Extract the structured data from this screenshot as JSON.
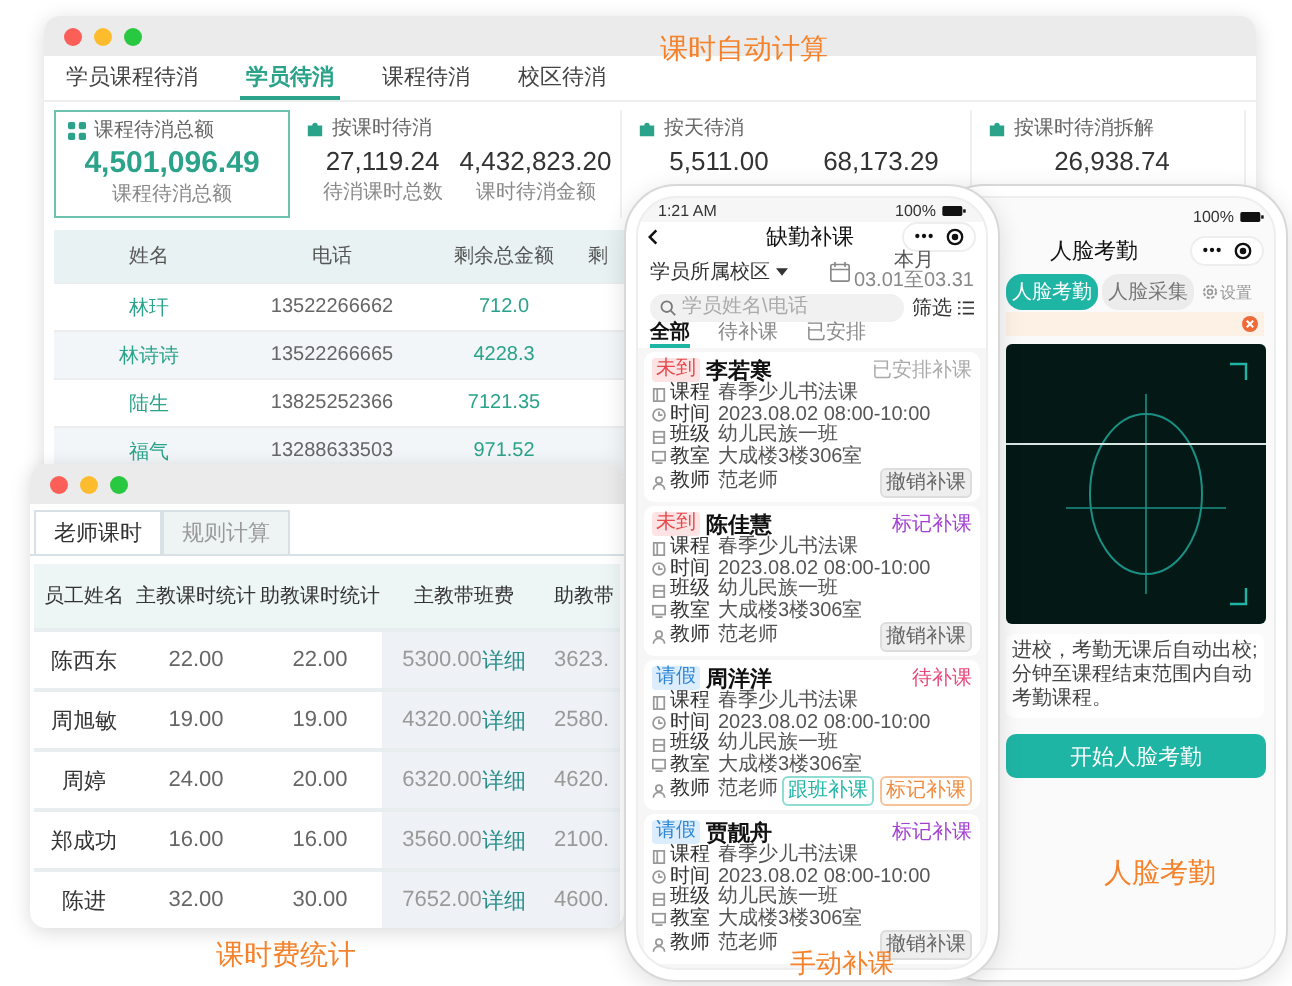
{
  "course_window": {
    "caption": "课时自动计算",
    "tabs": [
      {
        "label": "学员课程待消",
        "selected": false
      },
      {
        "label": "学员待消",
        "selected": true
      },
      {
        "label": "课程待消",
        "selected": false
      },
      {
        "label": "校区待消",
        "selected": false
      }
    ],
    "summary": {
      "title": "课程待消总额",
      "value": "4,501,096.49",
      "label": "课程待消总额"
    },
    "groups": [
      {
        "title": "按课时待消",
        "stats": [
          {
            "value": "27,119.24",
            "label": "待消课时总数"
          },
          {
            "value": "4,432,823.20",
            "label": "课时待消金额"
          }
        ]
      },
      {
        "title": "按天待消",
        "stats": [
          {
            "value": "5,511.00"
          },
          {
            "value": "68,173.29"
          }
        ]
      },
      {
        "title": "按课时待消拆解",
        "stats": [
          {
            "value": "26,938.74"
          }
        ]
      }
    ],
    "table": {
      "columns": [
        "姓名",
        "电话",
        "剩余总金额",
        "剩"
      ],
      "rows": [
        [
          "林玕",
          "13522266662",
          "712.0"
        ],
        [
          "林诗诗",
          "13522266665",
          "4228.3"
        ],
        [
          "陆生",
          "13825252366",
          "7121.35"
        ],
        [
          "福气",
          "13288633503",
          "971.52"
        ]
      ]
    }
  },
  "teacher_window": {
    "caption": "课时费统计",
    "tabs": [
      {
        "label": "老师课时",
        "selected": true
      },
      {
        "label": "规则计算",
        "selected": false
      }
    ],
    "table": {
      "columns": [
        "员工姓名",
        "主教课时统计",
        "助教课时统计",
        "主教带班费",
        "助教带"
      ],
      "rows": [
        {
          "cells": [
            "陈西东",
            "22.00",
            "22.00"
          ],
          "main_fee": "5300.00",
          "link": "详细",
          "column_5": "3623."
        },
        {
          "cells": [
            "周旭敏",
            "19.00",
            "19.00"
          ],
          "main_fee": "4320.00",
          "link": "详细",
          "column_5": "2580."
        },
        {
          "cells": [
            "周婷",
            "24.00",
            "20.00"
          ],
          "main_fee": "6320.00",
          "link": "详细",
          "column_5": "4620."
        },
        {
          "cells": [
            "郑成功",
            "16.00",
            "16.00"
          ],
          "main_fee": "3560.00",
          "link": "详细",
          "column_5": "2100."
        },
        {
          "cells": [
            "陈进",
            "32.00",
            "30.00"
          ],
          "main_fee": "7652.00",
          "link": "详细",
          "column_5": "4600."
        }
      ]
    }
  },
  "makeup_phone": {
    "caption": "手动补课",
    "time": "1:21 AM",
    "battery": "100%",
    "title": "缺勤补课",
    "campus": "学员所属校区",
    "period": {
      "label": "本月",
      "range": "03.01至03.31"
    },
    "search": {
      "placeholder": "学员姓名\\电话"
    },
    "filter": "筛选",
    "tabs": [
      {
        "label": "全部",
        "selected": true
      },
      {
        "label": "待补课",
        "selected": false
      },
      {
        "label": "已安排",
        "selected": false
      }
    ],
    "cards": [
      {
        "tag": {
          "label": "未到",
          "kind": "absent"
        },
        "name": "李若寒",
        "status": {
          "label": "已安排补课",
          "kind": "arranged"
        },
        "details": [
          {
            "kind": "course",
            "label": "课程",
            "value": "春季少儿书法课"
          },
          {
            "kind": "time",
            "label": "时间",
            "value": "2023.08.02  08:00-10:00"
          },
          {
            "kind": "class",
            "label": "班级",
            "value": "幼儿民族一班"
          },
          {
            "kind": "room",
            "label": "教室",
            "value": "大成楼3楼306室"
          },
          {
            "kind": "teacher",
            "label": "教师",
            "value": "范老师"
          }
        ],
        "buttons": [
          {
            "label": "撤销补课",
            "kind": "cancel"
          }
        ]
      },
      {
        "tag": {
          "label": "未到",
          "kind": "absent"
        },
        "name": "陈佳慧",
        "status": {
          "label": "标记补课",
          "kind": "mark"
        },
        "details": [
          {
            "kind": "course",
            "label": "课程",
            "value": "春季少儿书法课"
          },
          {
            "kind": "time",
            "label": "时间",
            "value": "2023.08.02  08:00-10:00"
          },
          {
            "kind": "class",
            "label": "班级",
            "value": "幼儿民族一班"
          },
          {
            "kind": "room",
            "label": "教室",
            "value": "大成楼3楼306室"
          },
          {
            "kind": "teacher",
            "label": "教师",
            "value": "范老师"
          }
        ],
        "buttons": [
          {
            "label": "撤销补课",
            "kind": "cancel"
          }
        ]
      },
      {
        "tag": {
          "label": "请假",
          "kind": "leave"
        },
        "name": "周洋洋",
        "status": {
          "label": "待补课",
          "kind": "pending"
        },
        "details": [
          {
            "kind": "course",
            "label": "课程",
            "value": "春季少儿书法课"
          },
          {
            "kind": "time",
            "label": "时间",
            "value": "2023.08.02  08:00-10:00"
          },
          {
            "kind": "class",
            "label": "班级",
            "value": "幼儿民族一班"
          },
          {
            "kind": "room",
            "label": "教室",
            "value": "大成楼3楼306室"
          },
          {
            "kind": "teacher",
            "label": "教师",
            "value": "范老师"
          }
        ],
        "buttons": [
          {
            "label": "跟班补课",
            "kind": "follow"
          },
          {
            "label": "标记补课",
            "kind": "mark"
          }
        ]
      },
      {
        "tag": {
          "label": "请假",
          "kind": "leave"
        },
        "name": "贾靓舟",
        "status": {
          "label": "标记补课",
          "kind": "mark"
        },
        "details": [
          {
            "kind": "course",
            "label": "课程",
            "value": "春季少儿书法课"
          },
          {
            "kind": "time",
            "label": "时间",
            "value": "2023.08.02  08:00-10:00"
          },
          {
            "kind": "class",
            "label": "班级",
            "value": "幼儿民族一班"
          },
          {
            "kind": "room",
            "label": "教室",
            "value": "大成楼3楼306室"
          },
          {
            "kind": "teacher",
            "label": "教师",
            "value": "范老师"
          }
        ],
        "buttons": [
          {
            "label": "撤销补课",
            "kind": "cancel"
          }
        ]
      }
    ]
  },
  "face_phone": {
    "caption": "人脸考勤",
    "battery": "100%",
    "title": "人脸考勤",
    "tabs": [
      {
        "label": "人脸考勤",
        "selected": true
      },
      {
        "label": "人脸采集",
        "selected": false
      }
    ],
    "settings": "设置",
    "notes": [
      "进校，考勤无课后自动出校;",
      "分钟至课程结束范围内自动考勤课程。"
    ],
    "button": "开始人脸考勤"
  }
}
